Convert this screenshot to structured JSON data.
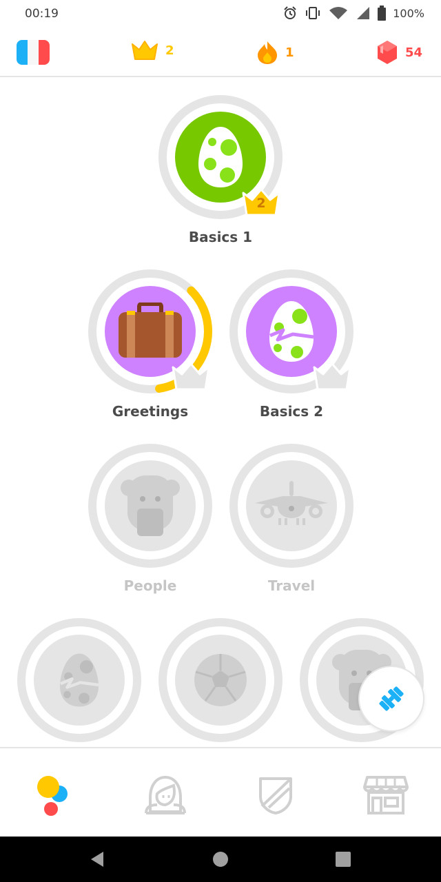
{
  "status_bar": {
    "time": "00:19",
    "battery": "100%"
  },
  "header": {
    "language_flag": "french-flag",
    "crowns": "2",
    "streak": "1",
    "gems": "54"
  },
  "skills": [
    {
      "label": "Basics 1",
      "icon": "egg-icon",
      "state": "completed",
      "crown_level": "2"
    },
    {
      "label": "Greetings",
      "icon": "suitcase-icon",
      "state": "in-progress",
      "progress": 0.35
    },
    {
      "label": "Basics 2",
      "icon": "cracked-egg-icon",
      "state": "unlocked"
    },
    {
      "label": "People",
      "icon": "person-face-icon",
      "state": "locked"
    },
    {
      "label": "Travel",
      "icon": "airplane-icon",
      "state": "locked"
    },
    {
      "label": "",
      "icon": "cracked-egg-icon",
      "state": "locked"
    },
    {
      "label": "",
      "icon": "soccer-ball-icon",
      "state": "locked"
    },
    {
      "label": "",
      "icon": "person-face-icon",
      "state": "locked"
    }
  ],
  "practice_button": {
    "icon": "dumbbell-icon"
  },
  "bottom_nav": [
    {
      "name": "learn",
      "icon": "learn-dots-icon",
      "active": true
    },
    {
      "name": "profile",
      "icon": "profile-icon",
      "active": false
    },
    {
      "name": "leaderboard",
      "icon": "shield-icon",
      "active": false
    },
    {
      "name": "shop",
      "icon": "shop-icon",
      "active": false
    }
  ],
  "colors": {
    "green": "#78c800",
    "purple": "#ce82ff",
    "gold": "#ffc800",
    "locked_gray": "#e5e5e5",
    "gem_red": "#ff4b4b",
    "streak_orange": "#ff9600",
    "practice_blue": "#1cb0f6"
  }
}
